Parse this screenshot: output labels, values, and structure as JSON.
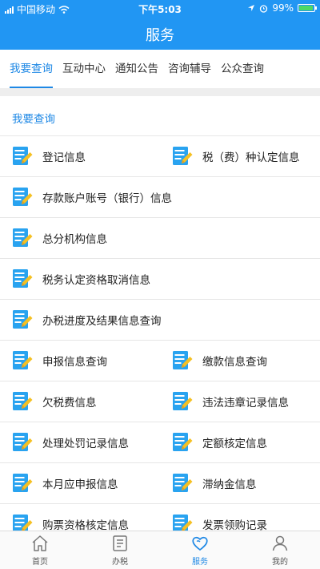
{
  "status_bar": {
    "carrier": "中国移动",
    "time": "下午5:03",
    "battery": "99%"
  },
  "header": {
    "title": "服务"
  },
  "tabs": [
    {
      "label": "我要查询",
      "active": true
    },
    {
      "label": "互动中心"
    },
    {
      "label": "通知公告"
    },
    {
      "label": "咨询辅导"
    },
    {
      "label": "公众查询"
    }
  ],
  "section": {
    "title": "我要查询"
  },
  "items": {
    "i0": "登记信息",
    "i1": "税（费）种认定信息",
    "i2": "存款账户账号（银行）信息",
    "i3": "总分机构信息",
    "i4": "税务认定资格取消信息",
    "i5": "办税进度及结果信息查询",
    "i6": "申报信息查询",
    "i7": "缴款信息查询",
    "i8": "欠税费信息",
    "i9": "违法违章记录信息",
    "i10": "处理处罚记录信息",
    "i11": "定额核定信息",
    "i12": "本月应申报信息",
    "i13": "滞纳金信息",
    "i14": "购票资格核定信息",
    "i15": "发票领购记录"
  },
  "tabbar": [
    {
      "label": "首页",
      "icon": "home-icon"
    },
    {
      "label": "办税",
      "icon": "list-icon"
    },
    {
      "label": "服务",
      "icon": "heart-icon",
      "active": true
    },
    {
      "label": "我的",
      "icon": "user-icon"
    }
  ],
  "colors": {
    "primary": "#2196f3",
    "accent": "#1e88e5",
    "battery": "#4cd964"
  }
}
